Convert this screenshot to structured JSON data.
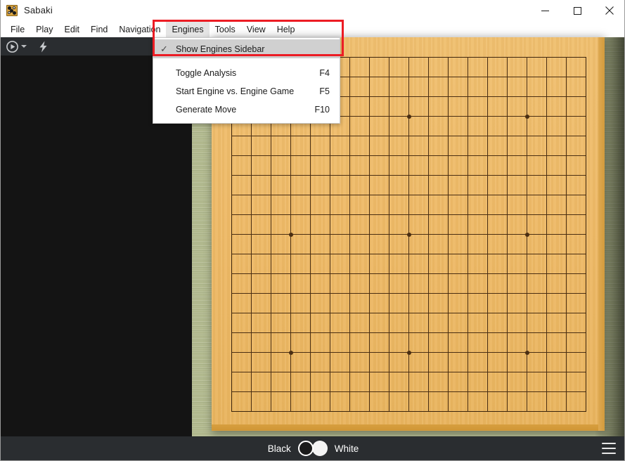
{
  "window": {
    "title": "Sabaki",
    "icon": "sabaki-app-icon",
    "controls": [
      {
        "name": "minimize",
        "glyph": "minimize-icon"
      },
      {
        "name": "maximize",
        "glyph": "maximize-icon"
      },
      {
        "name": "close",
        "glyph": "close-icon"
      }
    ]
  },
  "menubar": {
    "items": [
      {
        "label": "File",
        "active": false
      },
      {
        "label": "Play",
        "active": false
      },
      {
        "label": "Edit",
        "active": false
      },
      {
        "label": "Find",
        "active": false
      },
      {
        "label": "Navigation",
        "active": false
      },
      {
        "label": "Engines",
        "active": true
      },
      {
        "label": "Tools",
        "active": false
      },
      {
        "label": "View",
        "active": false
      },
      {
        "label": "Help",
        "active": false
      }
    ]
  },
  "engines_menu": {
    "open": true,
    "items": [
      {
        "label": "Show Engines Sidebar",
        "checked": true,
        "accelerator": "",
        "highlighted": true
      },
      {
        "label": "Toggle Analysis",
        "checked": false,
        "accelerator": "F4",
        "highlighted": false
      },
      {
        "label": "Start Engine vs. Engine Game",
        "checked": false,
        "accelerator": "F5",
        "highlighted": false
      },
      {
        "label": "Generate Move",
        "checked": false,
        "accelerator": "F10",
        "highlighted": false
      }
    ],
    "check_glyph": "✓"
  },
  "left_panel": {
    "toolbar": [
      {
        "name": "play-button",
        "icon": "play-circle-icon"
      },
      {
        "name": "play-dropdown",
        "icon": "chevron-down-icon"
      },
      {
        "name": "fast-play-button",
        "icon": "lightning-bolt-icon"
      }
    ]
  },
  "board": {
    "size": 19,
    "star_points": [
      [
        3,
        3
      ],
      [
        9,
        3
      ],
      [
        15,
        3
      ],
      [
        3,
        9
      ],
      [
        9,
        9
      ],
      [
        15,
        9
      ],
      [
        3,
        15
      ],
      [
        9,
        15
      ],
      [
        15,
        15
      ]
    ],
    "stones": []
  },
  "bottombar": {
    "black_label": "Black",
    "white_label": "White",
    "toggle_state": "black",
    "menu_icon": "hamburger-menu-icon"
  },
  "annotation": {
    "highlight_color": "#ec1c24",
    "target": "Engines menu and Show Engines Sidebar item"
  }
}
